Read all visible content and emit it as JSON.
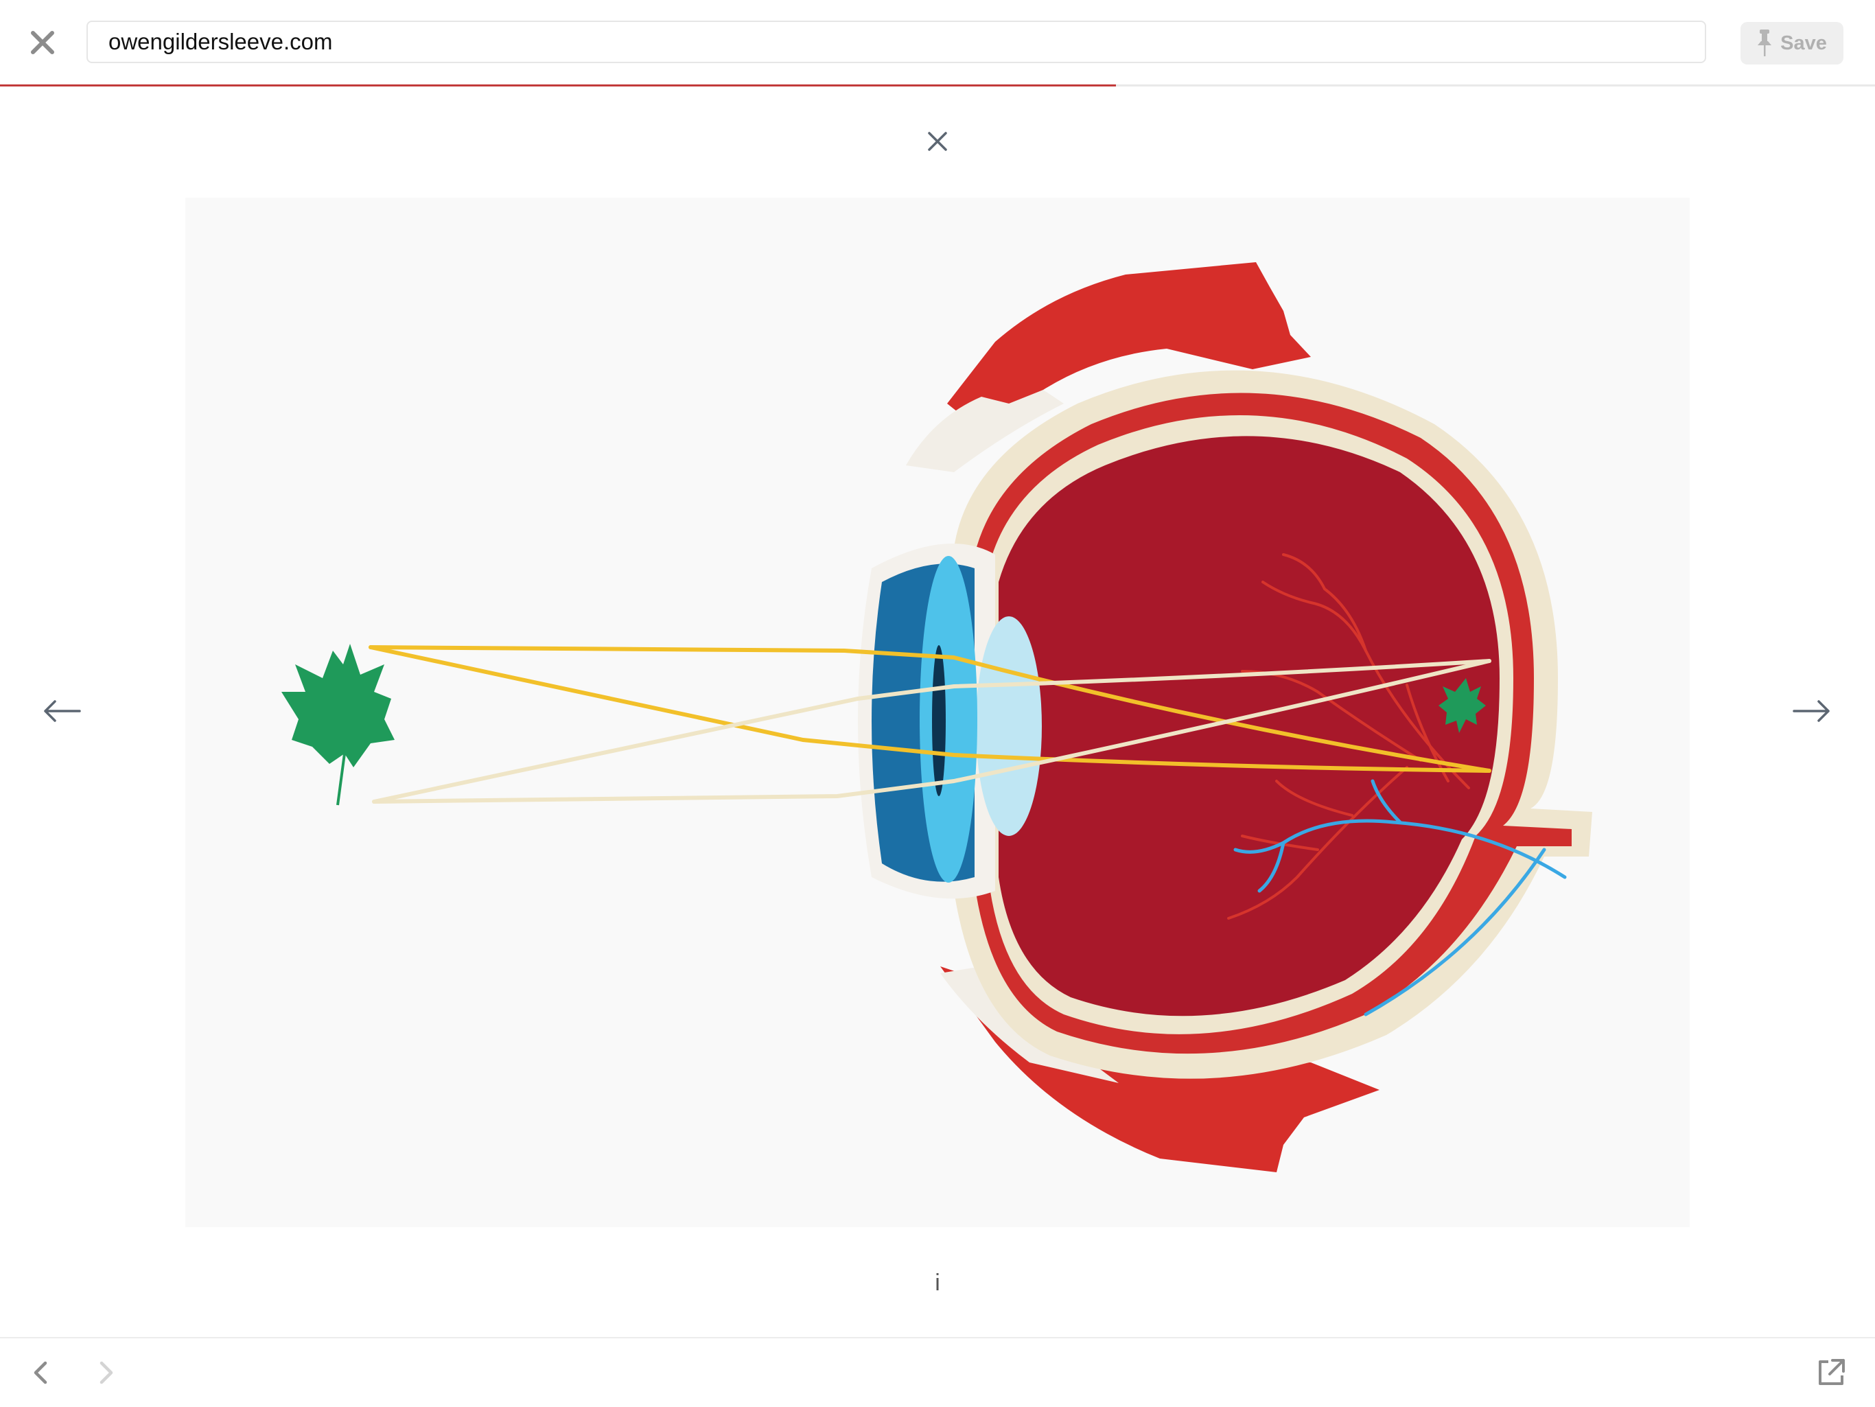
{
  "toolbar": {
    "close_icon": "close-icon",
    "url": "owengildersleeve.com",
    "save_label": "Save",
    "save_icon": "pin-icon",
    "load_progress": 0.595
  },
  "viewer": {
    "close_icon": "close-icon",
    "prev_icon": "arrow-left-icon",
    "next_icon": "arrow-right-icon",
    "info_label": "i"
  },
  "bottom_bar": {
    "back_icon": "chevron-left-icon",
    "forward_icon": "chevron-right-icon",
    "open_external_icon": "open-external-icon"
  },
  "colors": {
    "progress": "#c23a3a",
    "eye_red": "#a8182a",
    "muscle_red": "#d62e2a",
    "sclera": "#efe6cf",
    "cornea_blue": "#4ec2ea",
    "iris_blue": "#1b6fa5",
    "leaf_green": "#1f9a5a",
    "ray_yellow": "#f2c02a",
    "ray_cream": "#efe5c6"
  }
}
